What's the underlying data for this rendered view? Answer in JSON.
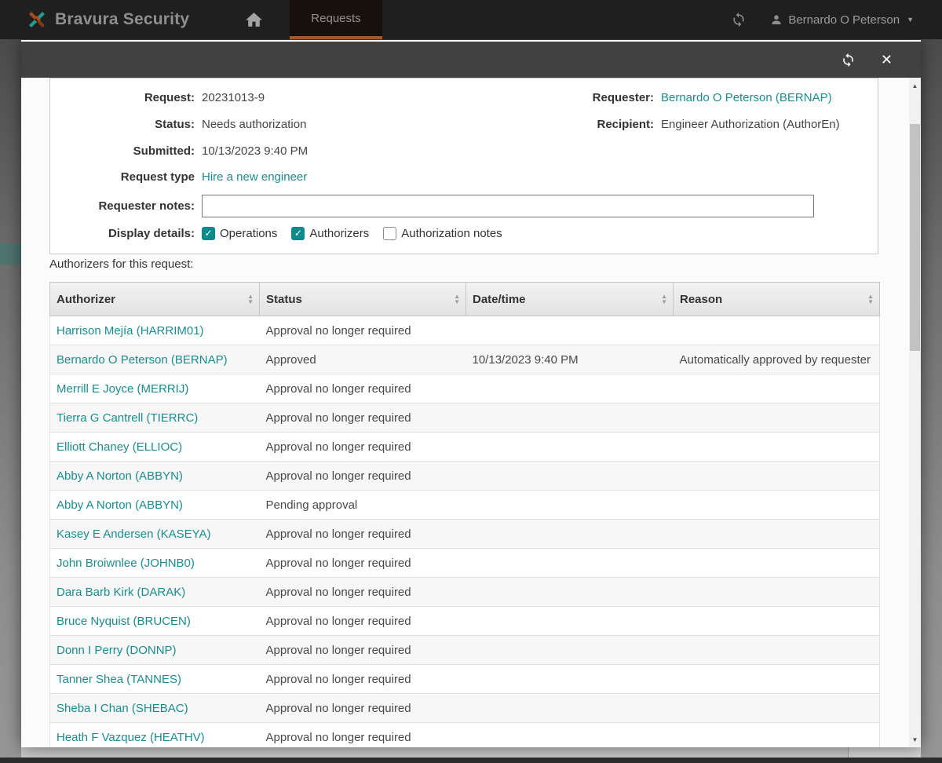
{
  "navbar": {
    "brand": "Bravura Security",
    "tab_requests": "Requests",
    "user_name": "Bernardo O Peterson"
  },
  "modal": {
    "details": {
      "request_label": "Request:",
      "request_value": "20231013-9",
      "status_label": "Status:",
      "status_value": "Needs authorization",
      "submitted_label": "Submitted:",
      "submitted_value": "10/13/2023 9:40 PM",
      "request_type_label": "Request type",
      "request_type_value": "Hire a new engineer",
      "requester_label": "Requester:",
      "requester_value": "Bernardo O Peterson (BERNAP)",
      "recipient_label": "Recipient:",
      "recipient_value": "Engineer Authorization (AuthorEn)",
      "notes_label": "Requester notes:",
      "notes_value": "",
      "display_label": "Display details:",
      "checkboxes": [
        {
          "label": "Operations",
          "checked": true
        },
        {
          "label": "Authorizers",
          "checked": true
        },
        {
          "label": "Authorization notes",
          "checked": false
        }
      ]
    },
    "table_title": "Authorizers for this request:",
    "table": {
      "columns": [
        "Authorizer",
        "Status",
        "Date/time",
        "Reason"
      ],
      "rows": [
        {
          "authorizer": "Harrison Mejía (HARRIM01)",
          "status": "Approval no longer required",
          "datetime": "",
          "reason": ""
        },
        {
          "authorizer": "Bernardo O Peterson (BERNAP)",
          "status": "Approved",
          "datetime": "10/13/2023 9:40 PM",
          "reason": "Automatically approved by requester"
        },
        {
          "authorizer": "Merrill E Joyce (MERRIJ)",
          "status": "Approval no longer required",
          "datetime": "",
          "reason": ""
        },
        {
          "authorizer": "Tierra G Cantrell (TIERRC)",
          "status": "Approval no longer required",
          "datetime": "",
          "reason": ""
        },
        {
          "authorizer": "Elliott Chaney (ELLIOC)",
          "status": "Approval no longer required",
          "datetime": "",
          "reason": ""
        },
        {
          "authorizer": "Abby A Norton (ABBYN)",
          "status": "Approval no longer required",
          "datetime": "",
          "reason": ""
        },
        {
          "authorizer": "Abby A Norton (ABBYN)",
          "status": "Pending approval",
          "datetime": "",
          "reason": ""
        },
        {
          "authorizer": "Kasey E Andersen (KASEYA)",
          "status": "Approval no longer required",
          "datetime": "",
          "reason": ""
        },
        {
          "authorizer": "John Broiwnlee (JOHNB0)",
          "status": "Approval no longer required",
          "datetime": "",
          "reason": ""
        },
        {
          "authorizer": "Dara Barb Kirk (DARAK)",
          "status": "Approval no longer required",
          "datetime": "",
          "reason": ""
        },
        {
          "authorizer": "Bruce Nyquist (BRUCEN)",
          "status": "Approval no longer required",
          "datetime": "",
          "reason": ""
        },
        {
          "authorizer": "Donn I Perry (DONNP)",
          "status": "Approval no longer required",
          "datetime": "",
          "reason": ""
        },
        {
          "authorizer": "Tanner Shea (TANNES)",
          "status": "Approval no longer required",
          "datetime": "",
          "reason": ""
        },
        {
          "authorizer": "Sheba I Chan (SHEBAC)",
          "status": "Approval no longer required",
          "datetime": "",
          "reason": ""
        },
        {
          "authorizer": "Heath F Vazquez (HEATHV)",
          "status": "Approval no longer required",
          "datetime": "",
          "reason": ""
        }
      ]
    }
  },
  "icons": {
    "sort_asc": "▲",
    "sort_desc": "▼",
    "caret_down": "▼",
    "close": "✕",
    "check": "✓",
    "scroll_up": "▲",
    "scroll_down": "▼"
  },
  "colors": {
    "accent_teal": "#1b8c8e",
    "checkbox_teal": "#0d8b8b",
    "accent_orange": "#ad5422",
    "navbar_bg": "#1f1f1f",
    "modal_header_bg": "#414141",
    "modal_bg": "#fbfbfb"
  }
}
